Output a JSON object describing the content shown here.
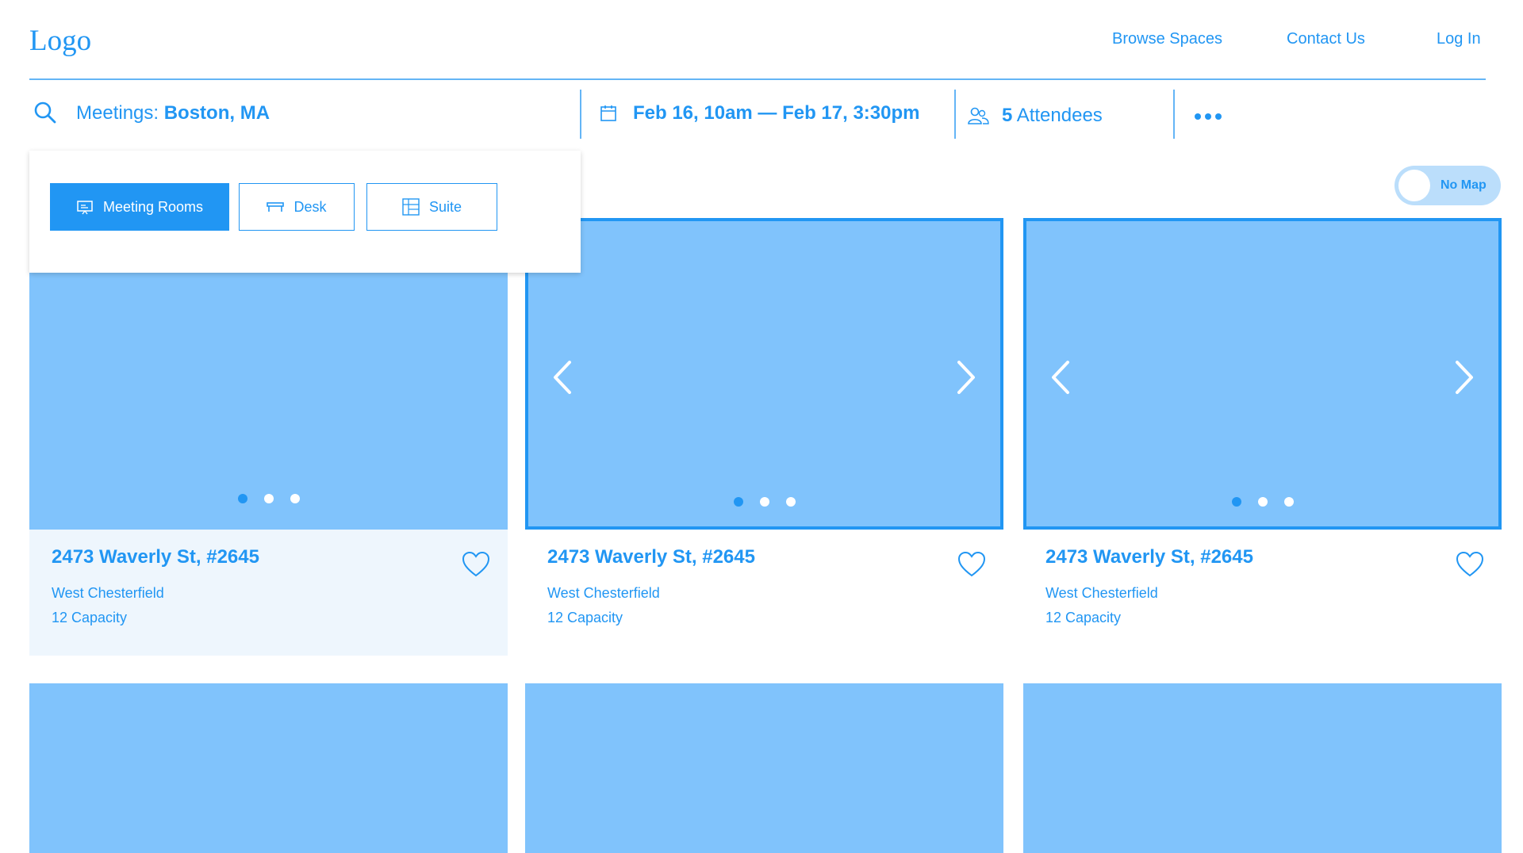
{
  "header": {
    "logo": "Logo",
    "nav": {
      "browse": "Browse Spaces",
      "contact": "Contact Us",
      "login": "Log In"
    }
  },
  "search": {
    "prefix": "Meetings: ",
    "location": "Boston, MA",
    "dates": "Feb 16, 10am — Feb 17, 3:30pm",
    "attendees_count": "5",
    "attendees_label": " Attendees"
  },
  "space_types": {
    "meeting_rooms": "Meeting Rooms",
    "desk": "Desk",
    "suite": "Suite",
    "selected": "Meeting Rooms"
  },
  "map_toggle": {
    "label": "No Map"
  },
  "listings": [
    {
      "title": "2473 Waverly St, #2645",
      "location": "West Chesterfield",
      "capacity": "12 Capacity"
    },
    {
      "title": "2473 Waverly St, #2645",
      "location": "West Chesterfield",
      "capacity": "12 Capacity"
    },
    {
      "title": "2473 Waverly St, #2645",
      "location": "West Chesterfield",
      "capacity": "12 Capacity"
    }
  ],
  "colors": {
    "accent": "#2196f3",
    "image_placeholder": "#80c3fc",
    "card_hover_bg": "#eef6fd"
  },
  "icons": [
    "search-icon",
    "calendar-icon",
    "attendees-icon",
    "more-icon",
    "presentation-icon",
    "desk-icon",
    "floorplan-icon",
    "chevron-left-icon",
    "chevron-right-icon",
    "heart-icon"
  ]
}
